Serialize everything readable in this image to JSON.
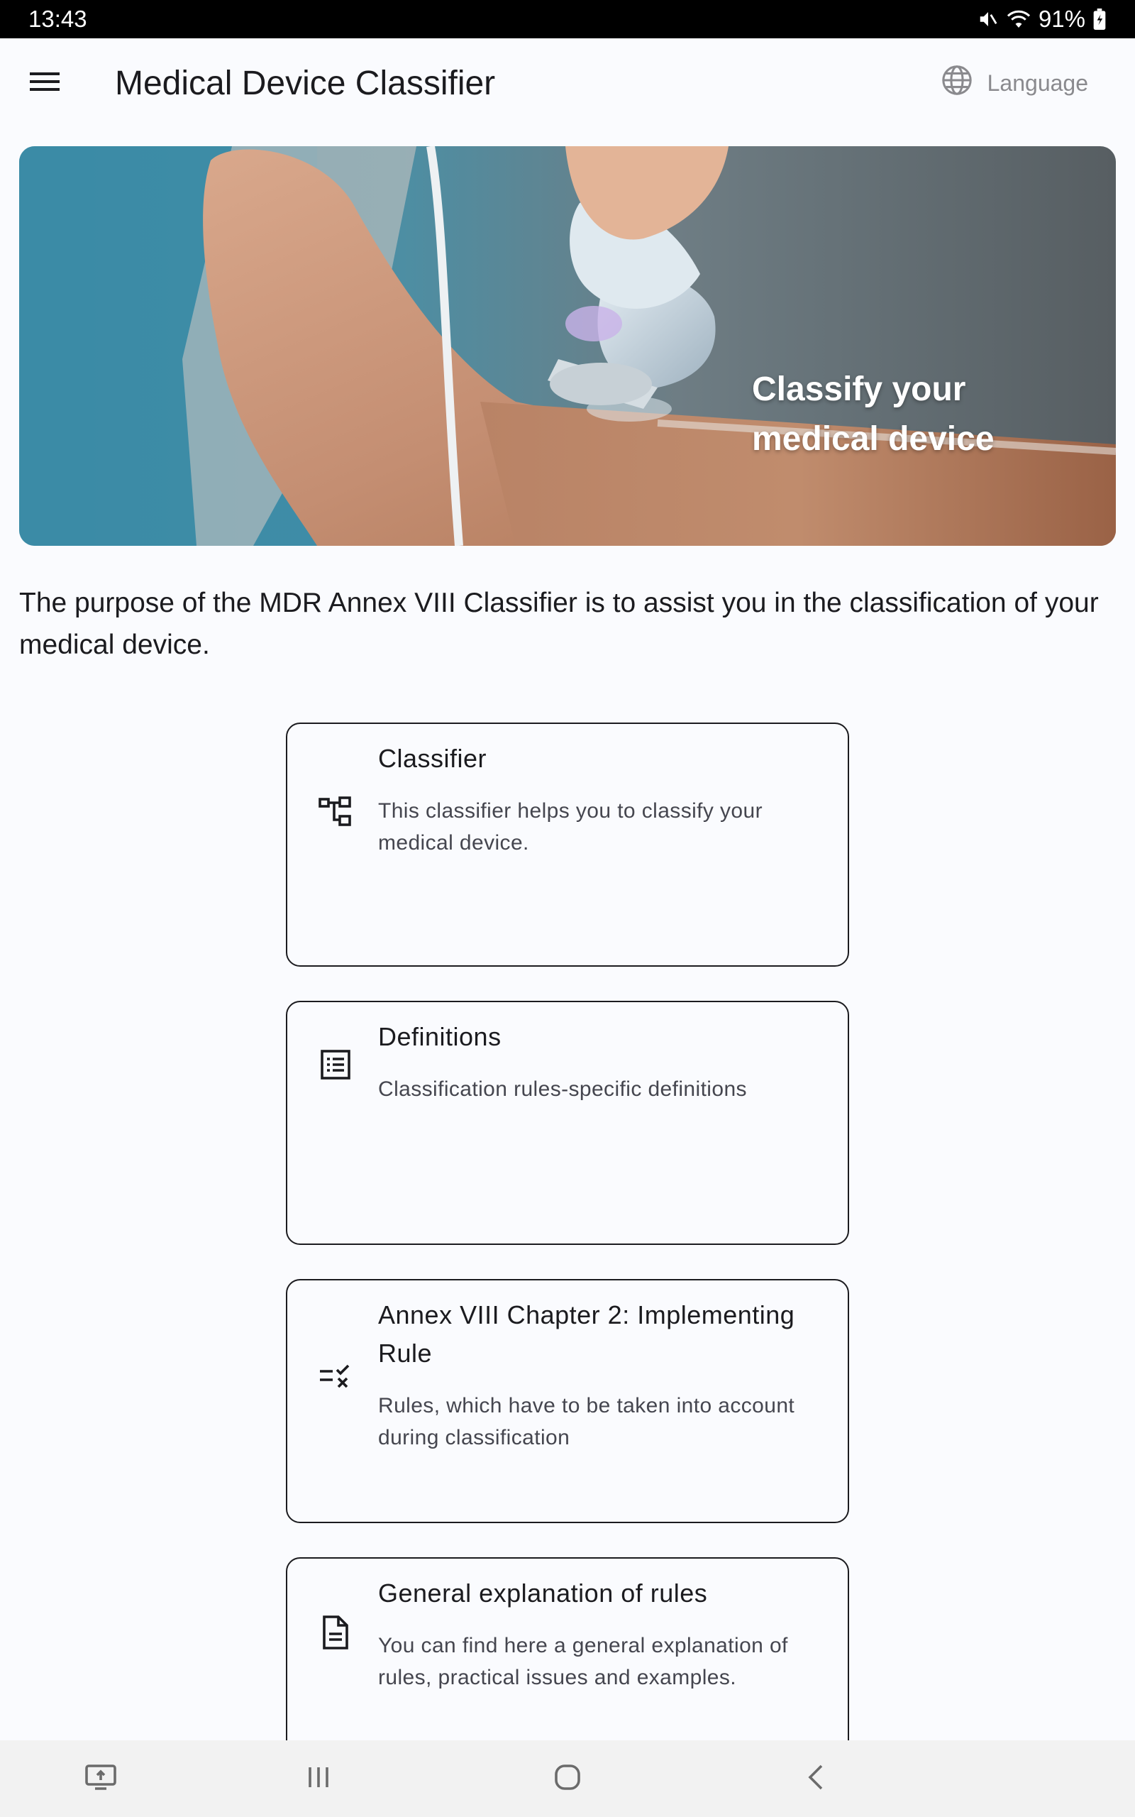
{
  "status_bar": {
    "time": "13:43",
    "battery": "91%",
    "icons": [
      "mute-icon",
      "wifi-icon",
      "battery-icon"
    ]
  },
  "app_bar": {
    "title": "Medical Device Classifier",
    "language_label": "Language",
    "menu_icon": "menu-icon",
    "language_icon": "globe-icon"
  },
  "hero": {
    "line1": "Classify your",
    "line2": "medical device"
  },
  "intro": "The purpose of the MDR Annex VIII Classifier is to assist you in the classification of your medical device.",
  "cards": [
    {
      "title": "Classifier",
      "description": "This classifier helps you to classify your medical device.",
      "icon": "account-tree-icon"
    },
    {
      "title": "Definitions",
      "description": "Classification rules-specific definitions",
      "icon": "list-alt-icon"
    },
    {
      "title": "Annex VIII Chapter 2: Implementing Rule",
      "description": "Rules, which have to be taken into account during classification",
      "icon": "rule-icon"
    },
    {
      "title": "General explanation of rules",
      "description": "You can find here a general explanation of rules, practical issues and examples.",
      "icon": "document-icon"
    }
  ],
  "nav_bar": {
    "buttons": [
      "screen-share-icon",
      "recent-apps-icon",
      "home-icon",
      "back-icon"
    ]
  },
  "colors": {
    "background": "#fafbfe",
    "text": "#1b1b1f",
    "secondary_text": "#45464f",
    "muted": "#8a8a8e"
  }
}
